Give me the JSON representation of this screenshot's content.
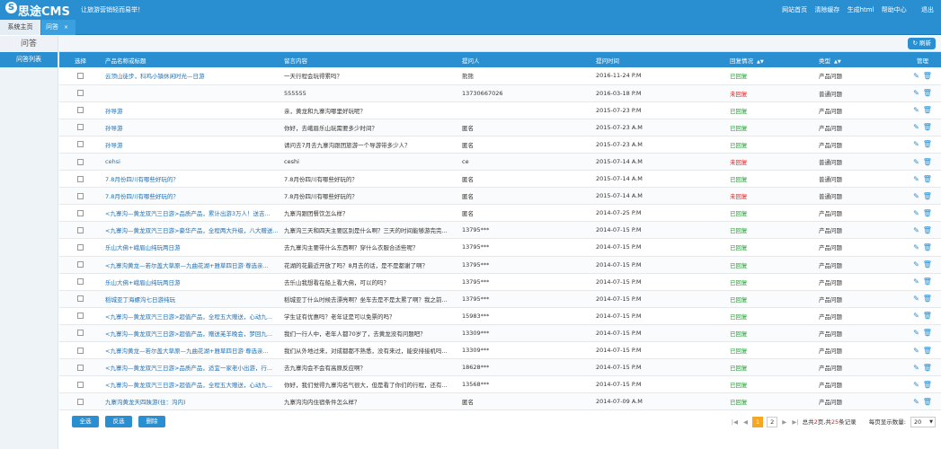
{
  "header": {
    "logo_text": "思途CMS",
    "logo_letter": "S",
    "slogan": "让旅游营销轻而易举！",
    "links": [
      "网站首页",
      "清除缓存",
      "生成html",
      "帮助中心"
    ],
    "exit_label": "退出",
    "colors": {
      "brand": "#2a8fd1"
    }
  },
  "tabs": {
    "home_label": "系统主页",
    "active_label": "问答",
    "close_icon": "×"
  },
  "crumb": {
    "title": "问答",
    "refresh_label": "刷新",
    "refresh_icon": "↻"
  },
  "sidebar": {
    "items": [
      {
        "label": "问答列表"
      }
    ]
  },
  "table": {
    "headers": {
      "select": "选择",
      "product": "产品名称或标题",
      "content": "留言内容",
      "asker": "提问人",
      "time": "提问时间",
      "reply": "回复情况",
      "type": "类型",
      "manage": "管理"
    },
    "sort_icon": "▲▼",
    "edit_icon": "✎",
    "delete_icon": "🗑",
    "rows": [
      {
        "product": "云顶山徒步，科鸡小镇休闲时光—日游",
        "content": "一天行程会玩得累吗？",
        "asker": "熊熊",
        "time": "2016-11-24 P.M",
        "reply": "已回复",
        "replied": true,
        "type": "产品问题"
      },
      {
        "product": "",
        "content": "555555",
        "asker": "13730667026",
        "time": "2016-03-18 P.M",
        "reply": "未回复",
        "replied": false,
        "type": "普通问题"
      },
      {
        "product": "孙导游",
        "content": "亲，黄龙和九寨沟哪里好玩呢？",
        "asker": "",
        "time": "2015-07-23 P.M",
        "reply": "已回复",
        "replied": true,
        "type": "产品问题"
      },
      {
        "product": "孙导游",
        "content": "你好，去峨眉乐山玩需要多少时间？",
        "asker": "匿名",
        "time": "2015-07-23 A.M",
        "reply": "已回复",
        "replied": true,
        "type": "产品问题"
      },
      {
        "product": "孙导游",
        "content": "请问去7月去九寨沟跟团旅游一个导游带多少人？",
        "asker": "匿名",
        "time": "2015-07-23 A.M",
        "reply": "已回复",
        "replied": true,
        "type": "产品问题"
      },
      {
        "product": "cehsi",
        "content": "ceshi",
        "asker": "ce",
        "time": "2015-07-14 A.M",
        "reply": "未回复",
        "replied": false,
        "type": "普通问题"
      },
      {
        "product": "7.8月份四川有哪些好玩的？",
        "content": "7.8月份四川有哪些好玩的？",
        "asker": "匿名",
        "time": "2015-07-14 A.M",
        "reply": "已回复",
        "replied": true,
        "type": "普通问题"
      },
      {
        "product": "7.8月份四川有哪些好玩的？",
        "content": "7.8月份四川有哪些好玩的？",
        "asker": "匿名",
        "time": "2015-07-14 A.M",
        "reply": "未回复",
        "replied": false,
        "type": "普通问题"
      },
      {
        "product": "<九寨沟—黄龙双汽三日游>品质产品，累计出游3万人！送吉...",
        "content": "九寨沟跟团餐饮怎么样？",
        "asker": "匿名",
        "time": "2014-07-25 P.M",
        "reply": "已回复",
        "replied": true,
        "type": "产品问题"
      },
      {
        "product": "<九寨沟—黄龙双汽三日游>豪华产品，全程两大升级，八大赠送...",
        "content": "九寨沟三天和四天主要区别是什么啊？三天的时间能够游完完...",
        "asker": "13795***",
        "time": "2014-07-15 P.M",
        "reply": "已回复",
        "replied": true,
        "type": "产品问题"
      },
      {
        "product": "乐山大佛+峨眉山纯玩两日游",
        "content": "去九寨沟主要带什么东西啊？穿什么衣服合适些呢？",
        "asker": "13795***",
        "time": "2014-07-15 P.M",
        "reply": "已回复",
        "replied": true,
        "type": "产品问题"
      },
      {
        "product": "<九寨沟黄龙—若尔盖大草原—九曲花湖+雅草四日游·尊选亲...",
        "content": "花湖的花最近开放了吗？8月去的话，是不是都谢了啊？",
        "asker": "13795***",
        "time": "2014-07-15 P.M",
        "reply": "已回复",
        "replied": true,
        "type": "产品问题"
      },
      {
        "product": "乐山大佛+峨眉山纯玩两日游",
        "content": "去乐山我想看在船上看大佛，可以的吗？",
        "asker": "13795***",
        "time": "2014-07-15 P.M",
        "reply": "已回复",
        "replied": true,
        "type": "产品问题"
      },
      {
        "product": "稻城亚丁海螺沟七日游纯玩",
        "content": "稻城亚丁什么时候去漂亮啊？坐车去是不是太累了啊？我之前...",
        "asker": "13795***",
        "time": "2014-07-15 P.M",
        "reply": "已回复",
        "replied": true,
        "type": "产品问题"
      },
      {
        "product": "<九寨沟—黄龙双汽三日游>超值产品，全程五大赠送，心动九...",
        "content": "学生证有优惠吗？老年证是可以免票的吗？",
        "asker": "15983***",
        "time": "2014-07-15 P.M",
        "reply": "已回复",
        "replied": true,
        "type": "产品问题"
      },
      {
        "product": "<九寨沟—黄龙双汽三日游>超值产品，赠送羌羊晚会，梦回九...",
        "content": "我们一行人中，老年人都70岁了，去黄龙没有问题吧？",
        "asker": "13309***",
        "time": "2014-07-15 P.M",
        "reply": "已回复",
        "replied": true,
        "type": "产品问题"
      },
      {
        "product": "<九寨沟黄龙—若尔盖大草原—九曲花湖+雅草四日游·尊选亲...",
        "content": "我们从外地过来，对成都都不熟悉，没有来过，能安排接机吗...",
        "asker": "13309***",
        "time": "2014-07-15 P.M",
        "reply": "已回复",
        "replied": true,
        "type": "产品问题"
      },
      {
        "product": "<九寨沟—黄龙双汽三日游>品质产品，适宜一家老小出游，行...",
        "content": "去九寨沟会不会有高原反应啊？",
        "asker": "18628***",
        "time": "2014-07-15 P.M",
        "reply": "已回复",
        "replied": true,
        "type": "产品问题"
      },
      {
        "product": "<九寨沟—黄龙双汽三日游>超值产品，全程五大赠送，心动九...",
        "content": "你好，我们觉得九寨沟名气很大，但是看了你们的行程，还有...",
        "asker": "13568***",
        "time": "2014-07-15 P.M",
        "reply": "已回复",
        "replied": true,
        "type": "产品问题"
      },
      {
        "product": "九寨沟黄龙天四陕游(住：沟内)",
        "content": "九寨沟沟内住宿条件怎么样？",
        "asker": "匿名",
        "time": "2014-07-09 A.M",
        "reply": "已回复",
        "replied": true,
        "type": "产品问题"
      }
    ]
  },
  "footer": {
    "buttons": [
      "全选",
      "反选",
      "删除"
    ],
    "pager": {
      "first_icon": "|◀",
      "prev_icon": "◀",
      "next_icon": "▶",
      "last_icon": "▶|",
      "pages": [
        "1",
        "2"
      ],
      "current": "1",
      "total_prefix": "总共",
      "total_pages": "2",
      "total_mid": "页,共",
      "total_records": "25",
      "total_suffix": "条记录",
      "per_page_label": "每页显示数量:",
      "per_page_value": "20"
    }
  }
}
